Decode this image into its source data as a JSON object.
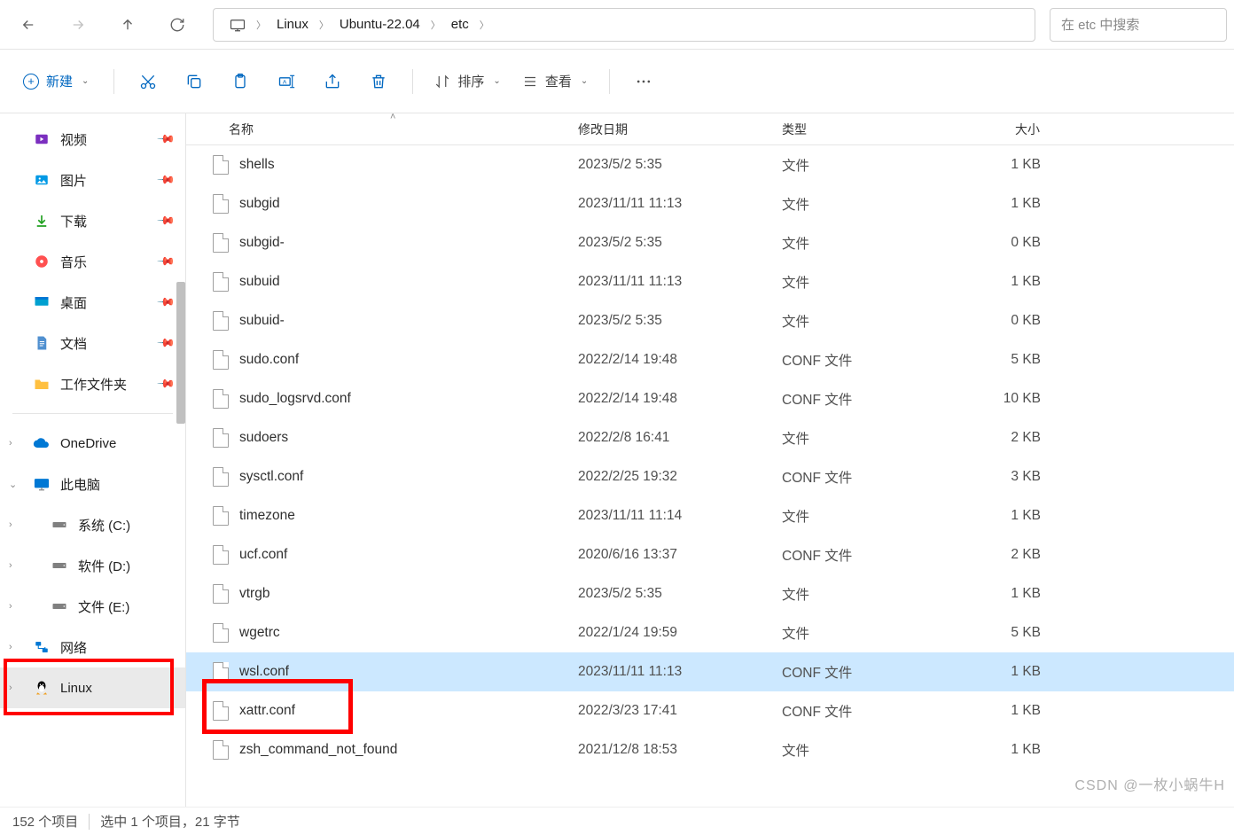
{
  "nav": {
    "breadcrumb": [
      "Linux",
      "Ubuntu-22.04",
      "etc"
    ],
    "search_placeholder": "在 etc 中搜索"
  },
  "toolbar": {
    "new_label": "新建",
    "sort_label": "排序",
    "view_label": "查看"
  },
  "sidebar": {
    "quick": [
      {
        "label": "视频",
        "icon": "video",
        "color": "#7b2fbf"
      },
      {
        "label": "图片",
        "icon": "picture",
        "color": "#0099e5"
      },
      {
        "label": "下载",
        "icon": "download",
        "color": "#20a020"
      },
      {
        "label": "音乐",
        "icon": "music",
        "color": "#ff5050"
      },
      {
        "label": "桌面",
        "icon": "desktop",
        "color": "#00a0d0"
      },
      {
        "label": "文档",
        "icon": "document",
        "color": "#5090d0"
      },
      {
        "label": "工作文件夹",
        "icon": "folder",
        "color": "#ffc040"
      }
    ],
    "tree": [
      {
        "label": "OneDrive",
        "icon": "cloud",
        "color": "#0078d4",
        "chev": "›",
        "indent": 0
      },
      {
        "label": "此电脑",
        "icon": "pc",
        "color": "#0078d4",
        "chev": "⌄",
        "indent": 0
      },
      {
        "label": "系统 (C:)",
        "icon": "drive",
        "color": "#505050",
        "chev": "›",
        "indent": 1
      },
      {
        "label": "软件 (D:)",
        "icon": "drive",
        "color": "#505050",
        "chev": "›",
        "indent": 1
      },
      {
        "label": "文件 (E:)",
        "icon": "drive",
        "color": "#505050",
        "chev": "›",
        "indent": 1
      },
      {
        "label": "网络",
        "icon": "network",
        "color": "#0078d4",
        "chev": "›",
        "indent": 0
      },
      {
        "label": "Linux",
        "icon": "linux",
        "color": "#000",
        "chev": "›",
        "indent": 0,
        "highlighted": true
      }
    ]
  },
  "columns": {
    "name": "名称",
    "date": "修改日期",
    "type": "类型",
    "size": "大小"
  },
  "files": [
    {
      "name": "shells",
      "date": "2023/5/2 5:35",
      "type": "文件",
      "size": "1 KB"
    },
    {
      "name": "subgid",
      "date": "2023/11/11 11:13",
      "type": "文件",
      "size": "1 KB"
    },
    {
      "name": "subgid-",
      "date": "2023/5/2 5:35",
      "type": "文件",
      "size": "0 KB"
    },
    {
      "name": "subuid",
      "date": "2023/11/11 11:13",
      "type": "文件",
      "size": "1 KB"
    },
    {
      "name": "subuid-",
      "date": "2023/5/2 5:35",
      "type": "文件",
      "size": "0 KB"
    },
    {
      "name": "sudo.conf",
      "date": "2022/2/14 19:48",
      "type": "CONF 文件",
      "size": "5 KB"
    },
    {
      "name": "sudo_logsrvd.conf",
      "date": "2022/2/14 19:48",
      "type": "CONF 文件",
      "size": "10 KB"
    },
    {
      "name": "sudoers",
      "date": "2022/2/8 16:41",
      "type": "文件",
      "size": "2 KB"
    },
    {
      "name": "sysctl.conf",
      "date": "2022/2/25 19:32",
      "type": "CONF 文件",
      "size": "3 KB"
    },
    {
      "name": "timezone",
      "date": "2023/11/11 11:14",
      "type": "文件",
      "size": "1 KB"
    },
    {
      "name": "ucf.conf",
      "date": "2020/6/16 13:37",
      "type": "CONF 文件",
      "size": "2 KB"
    },
    {
      "name": "vtrgb",
      "date": "2023/5/2 5:35",
      "type": "文件",
      "size": "1 KB"
    },
    {
      "name": "wgetrc",
      "date": "2022/1/24 19:59",
      "type": "文件",
      "size": "5 KB"
    },
    {
      "name": "wsl.conf",
      "date": "2023/11/11 11:13",
      "type": "CONF 文件",
      "size": "1 KB",
      "selected": true,
      "redbox": true
    },
    {
      "name": "xattr.conf",
      "date": "2022/3/23 17:41",
      "type": "CONF 文件",
      "size": "1 KB"
    },
    {
      "name": "zsh_command_not_found",
      "date": "2021/12/8 18:53",
      "type": "文件",
      "size": "1 KB"
    }
  ],
  "status": {
    "items": "152 个项目",
    "selected": "选中 1 个项目，21 字节"
  },
  "watermark": "CSDN @一枚小蜗牛H"
}
